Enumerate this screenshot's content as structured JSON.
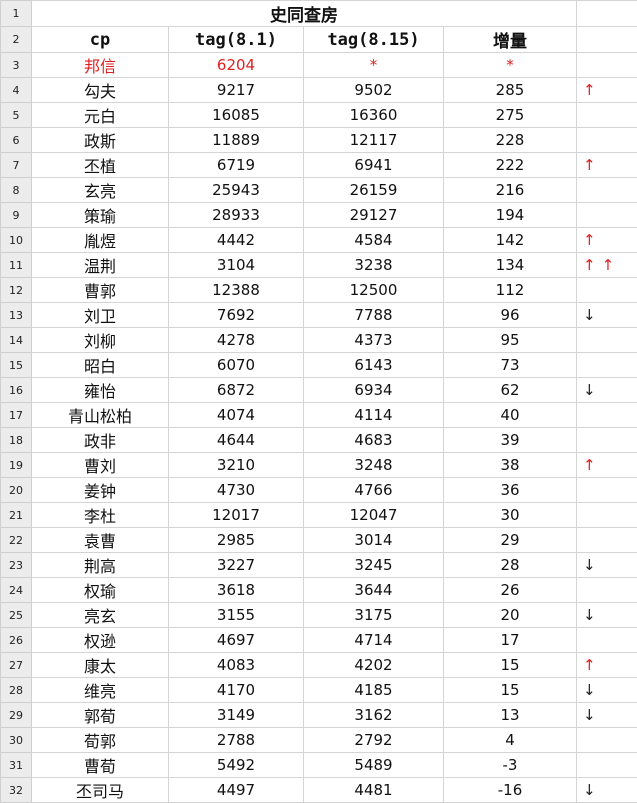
{
  "sheet": {
    "title": "史同查房",
    "headers": {
      "cp": "cp",
      "tag1": "tag(8.1)",
      "tag2": "tag(8.15)",
      "increase": "增量"
    },
    "row_numbers": [
      "1",
      "2",
      "3",
      "4",
      "5",
      "6",
      "7",
      "8",
      "9",
      "10",
      "11",
      "12",
      "13",
      "14",
      "15",
      "16",
      "17",
      "18",
      "19",
      "20",
      "21",
      "22",
      "23",
      "24",
      "25",
      "26",
      "27",
      "28",
      "29",
      "30",
      "31",
      "32"
    ],
    "rows": [
      {
        "cp": "邦信",
        "tag1": "6204",
        "tag2": "*",
        "inc": "*",
        "arrow": "",
        "highlight": true
      },
      {
        "cp": "勾夫",
        "tag1": "9217",
        "tag2": "9502",
        "inc": "285",
        "arrow": "↑"
      },
      {
        "cp": "元白",
        "tag1": "16085",
        "tag2": "16360",
        "inc": "275",
        "arrow": ""
      },
      {
        "cp": "政斯",
        "tag1": "11889",
        "tag2": "12117",
        "inc": "228",
        "arrow": ""
      },
      {
        "cp": "丕植",
        "tag1": "6719",
        "tag2": "6941",
        "inc": "222",
        "arrow": "↑"
      },
      {
        "cp": "玄亮",
        "tag1": "25943",
        "tag2": "26159",
        "inc": "216",
        "arrow": ""
      },
      {
        "cp": "策瑜",
        "tag1": "28933",
        "tag2": "29127",
        "inc": "194",
        "arrow": ""
      },
      {
        "cp": "胤煜",
        "tag1": "4442",
        "tag2": "4584",
        "inc": "142",
        "arrow": "↑"
      },
      {
        "cp": "温荆",
        "tag1": "3104",
        "tag2": "3238",
        "inc": "134",
        "arrow": "↑↑"
      },
      {
        "cp": "曹郭",
        "tag1": "12388",
        "tag2": "12500",
        "inc": "112",
        "arrow": ""
      },
      {
        "cp": "刘卫",
        "tag1": "7692",
        "tag2": "7788",
        "inc": "96",
        "arrow": "↓"
      },
      {
        "cp": "刘柳",
        "tag1": "4278",
        "tag2": "4373",
        "inc": "95",
        "arrow": ""
      },
      {
        "cp": "昭白",
        "tag1": "6070",
        "tag2": "6143",
        "inc": "73",
        "arrow": ""
      },
      {
        "cp": "雍怡",
        "tag1": "6872",
        "tag2": "6934",
        "inc": "62",
        "arrow": "↓"
      },
      {
        "cp": "青山松柏",
        "tag1": "4074",
        "tag2": "4114",
        "inc": "40",
        "arrow": ""
      },
      {
        "cp": "政非",
        "tag1": "4644",
        "tag2": "4683",
        "inc": "39",
        "arrow": ""
      },
      {
        "cp": "曹刘",
        "tag1": "3210",
        "tag2": "3248",
        "inc": "38",
        "arrow": "↑"
      },
      {
        "cp": "姜钟",
        "tag1": "4730",
        "tag2": "4766",
        "inc": "36",
        "arrow": ""
      },
      {
        "cp": "李杜",
        "tag1": "12017",
        "tag2": "12047",
        "inc": "30",
        "arrow": ""
      },
      {
        "cp": "袁曹",
        "tag1": "2985",
        "tag2": "3014",
        "inc": "29",
        "arrow": ""
      },
      {
        "cp": "荆高",
        "tag1": "3227",
        "tag2": "3245",
        "inc": "28",
        "arrow": "↓"
      },
      {
        "cp": "权瑜",
        "tag1": "3618",
        "tag2": "3644",
        "inc": "26",
        "arrow": ""
      },
      {
        "cp": "亮玄",
        "tag1": "3155",
        "tag2": "3175",
        "inc": "20",
        "arrow": "↓"
      },
      {
        "cp": "权逊",
        "tag1": "4697",
        "tag2": "4714",
        "inc": "17",
        "arrow": ""
      },
      {
        "cp": "康太",
        "tag1": "4083",
        "tag2": "4202",
        "inc": "15",
        "arrow": "↑"
      },
      {
        "cp": "维亮",
        "tag1": "4170",
        "tag2": "4185",
        "inc": "15",
        "arrow": "↓"
      },
      {
        "cp": "郭荀",
        "tag1": "3149",
        "tag2": "3162",
        "inc": "13",
        "arrow": "↓"
      },
      {
        "cp": "荀郭",
        "tag1": "2788",
        "tag2": "2792",
        "inc": "4",
        "arrow": ""
      },
      {
        "cp": "曹荀",
        "tag1": "5492",
        "tag2": "5489",
        "inc": "-3",
        "arrow": ""
      },
      {
        "cp": "丕司马",
        "tag1": "4497",
        "tag2": "4481",
        "inc": "-16",
        "arrow": "↓"
      }
    ],
    "colors": {
      "highlight": "#e02020",
      "up_arrow": "#e02020",
      "down_arrow": "#222222",
      "row_header_bg": "#ececec",
      "grid": "#d4d4d4"
    }
  }
}
